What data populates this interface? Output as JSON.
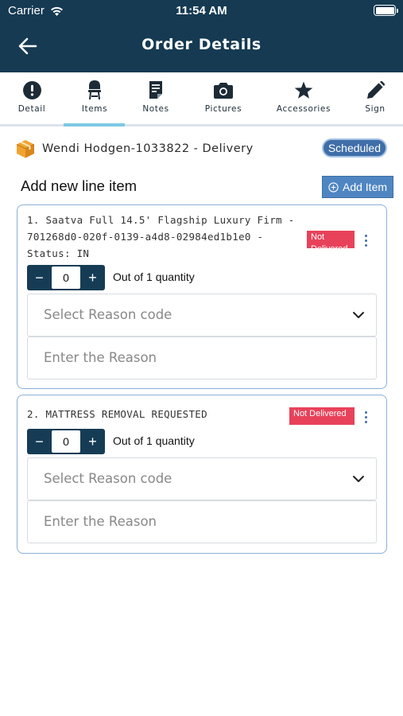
{
  "status_bar": {
    "carrier": "Carrier",
    "time": "11:54 AM"
  },
  "header": {
    "title": "Order Details"
  },
  "tabs": [
    {
      "label": "Detail",
      "icon": "alert-circle-icon"
    },
    {
      "label": "Items",
      "icon": "chair-icon"
    },
    {
      "label": "Notes",
      "icon": "notes-icon"
    },
    {
      "label": "Pictures",
      "icon": "camera-icon"
    },
    {
      "label": "Accessories",
      "icon": "star-icon"
    },
    {
      "label": "Sign",
      "icon": "pencil-icon"
    }
  ],
  "active_tab": "Items",
  "customer": {
    "name": "Wendi Hodgen-1033822 - Delivery",
    "status": "Scheduled",
    "icon": "package-icon"
  },
  "section": {
    "title": "Add new line item",
    "add_button": "Add Item"
  },
  "line_items": [
    {
      "description": "1. Saatva Full 14.5' Flagship Luxury Firm - 701268d0-020f-0139-a4d8-02984ed1b1e0 - Status: IN",
      "status": "Not Delivered",
      "quantity": "0",
      "quantity_label": "Out of 1 quantity",
      "reason_code_placeholder": "Select Reason code",
      "reason_placeholder": "Enter the Reason"
    },
    {
      "description": "2. MATTRESS REMOVAL REQUESTED",
      "status": "Not Delivered",
      "quantity": "0",
      "quantity_label": "Out of 1 quantity",
      "reason_code_placeholder": "Select Reason code",
      "reason_placeholder": "Enter the Reason"
    }
  ],
  "colors": {
    "header_bg": "#153a52",
    "accent": "#4f86c2",
    "status_tag": "#e8425a",
    "tab_indicator": "#7ec8e3",
    "package": "#f0a430"
  }
}
